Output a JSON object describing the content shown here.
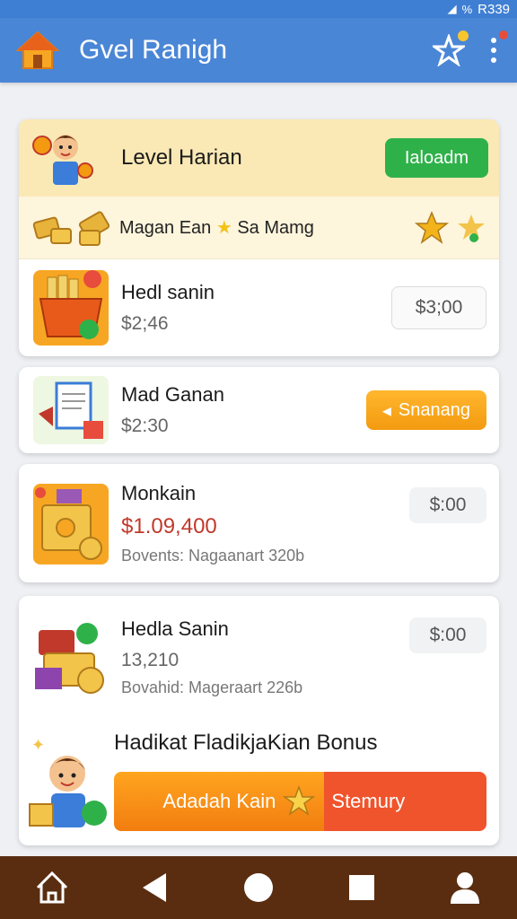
{
  "status_bar": {
    "signal": "◢",
    "battery": "R339",
    "misc": "%"
  },
  "app_bar": {
    "title": "Gvel Ranigh"
  },
  "hero": {
    "title": "Level Harian",
    "button_label": "Ialoadm",
    "subtitle_part1": "Magan Ean",
    "subtitle_part2": "Sa Mamg",
    "row_title": "Hedl sanin",
    "row_price": "$2;46",
    "row_value": "$3;00"
  },
  "items": [
    {
      "title": "Mad Ganan",
      "price": "$2:30",
      "button_label": "Snanang"
    },
    {
      "title": "Monkain",
      "price": "$1.09,400",
      "sub": "Bovents: Nagaanart 320b",
      "value": "$:00"
    },
    {
      "title": "Hedla Sanin",
      "price": "13,210",
      "sub": "Bovahid: Mageraart 226b",
      "value": "$:00"
    }
  ],
  "bonus": {
    "title": "Hadikat FladikjaKian Bonus",
    "left_label": "Adadah Kain",
    "right_label": "Stemury"
  },
  "colors": {
    "primary": "#4a86d6",
    "green": "#2fb14a",
    "orange": "#f39a10",
    "nav": "#5a2d10"
  }
}
